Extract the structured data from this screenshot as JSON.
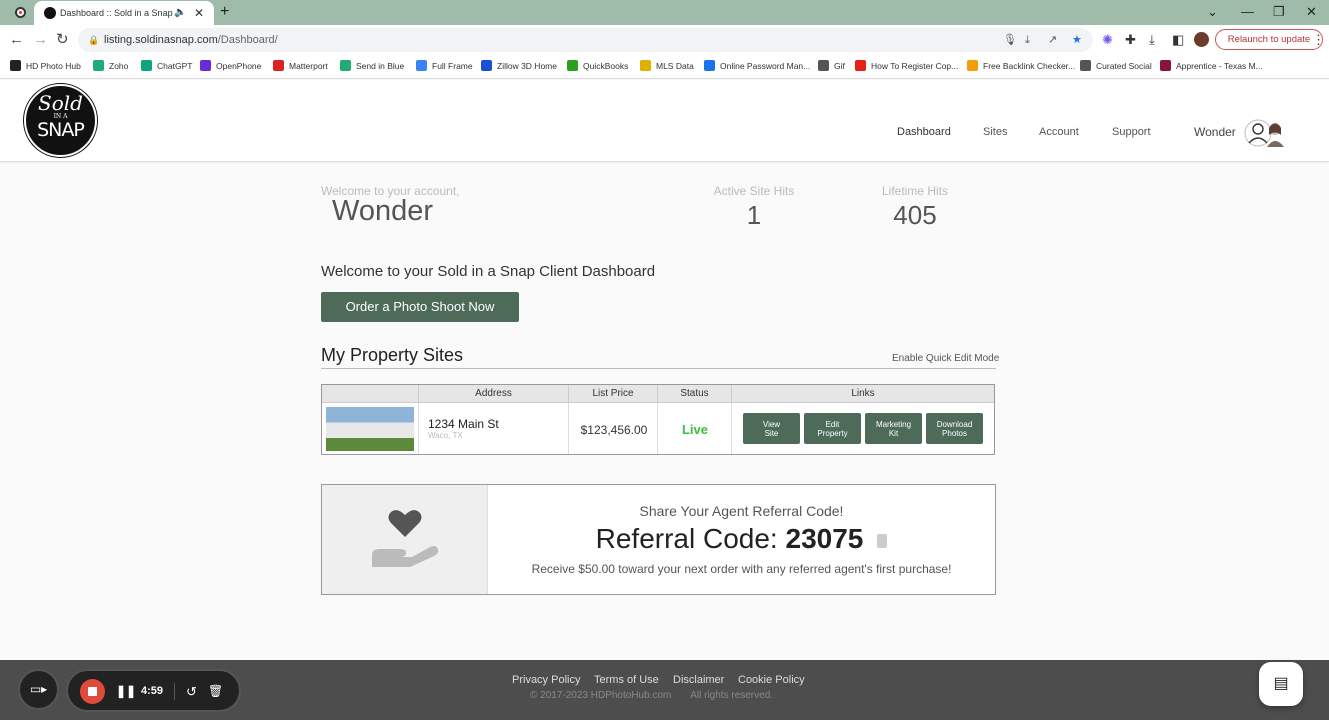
{
  "browser": {
    "tab_title": "Dashboard :: Sold in a Snap",
    "new_tab": "+",
    "url_host": "listing.soldinasnap.com",
    "url_path": "/Dashboard/",
    "relaunch": "Relaunch to update",
    "bookmarks": [
      "HD Photo Hub",
      "Zoho",
      "ChatGPT",
      "OpenPhone",
      "Matterport",
      "Send in Blue",
      "Full Frame",
      "Zillow 3D Home",
      "QuickBooks",
      "MLS Data",
      "Online Password Man...",
      "Gif",
      "How To Register Cop...",
      "Free Backlink Checker...",
      "Curated Social",
      "Apprentice - Texas M..."
    ],
    "bookmark_colors": [
      "#222",
      "#2a7",
      "#10a37f",
      "#6c2bd9",
      "#d22",
      "#2a7",
      "#3b82f6",
      "#1d4ed8",
      "#2ca01c",
      "#e0b000",
      "#1a73e8",
      "#555",
      "#e62117",
      "#f59e0b",
      "#555",
      "#8b1538"
    ]
  },
  "logo": {
    "line1": "Sold",
    "line2": "IN A",
    "line3": "SNAP"
  },
  "nav": {
    "items": [
      "Dashboard",
      "Sites",
      "Account",
      "Support"
    ],
    "active": "Dashboard"
  },
  "user": {
    "name": "Wonder"
  },
  "stats": {
    "welcome_label": "Welcome to your account,",
    "welcome_name": "Wonder",
    "active_label": "Active Site Hits",
    "active_value": "1",
    "lifetime_label": "Lifetime Hits",
    "lifetime_value": "405"
  },
  "dashboard_heading": "Welcome to your Sold in a Snap Client Dashboard",
  "order_button": "Order a Photo Shoot Now",
  "properties": {
    "title": "My Property Sites",
    "quick_edit": "Enable Quick Edit Mode",
    "headers": [
      "",
      "Address",
      "List Price",
      "Status",
      "Links"
    ],
    "rows": [
      {
        "address": "1234 Main St",
        "city": "Waco, TX",
        "price": "$123,456.00",
        "status": "Live"
      }
    ],
    "link_buttons": [
      [
        "View",
        "Site"
      ],
      [
        "Edit",
        "Property"
      ],
      [
        "Marketing",
        "Kit"
      ],
      [
        "Download",
        "Photos"
      ]
    ]
  },
  "referral": {
    "share": "Share Your Agent Referral Code!",
    "code_label": "Referral Code:",
    "code": "23075",
    "description": "Receive $50.00 toward your next order with any referred agent's first purchase!"
  },
  "footer": {
    "links": [
      "Privacy Policy",
      "Terms of Use",
      "Disclaimer",
      "Cookie Policy"
    ],
    "copyright": "© 2017-2023 HDPhotoHub.com       All rights reserved."
  },
  "recorder": {
    "time": "4:59"
  },
  "colors": {
    "accent": "#4e6b5a",
    "live": "#3cbf3c",
    "tabbar": "#9fbcaa"
  }
}
